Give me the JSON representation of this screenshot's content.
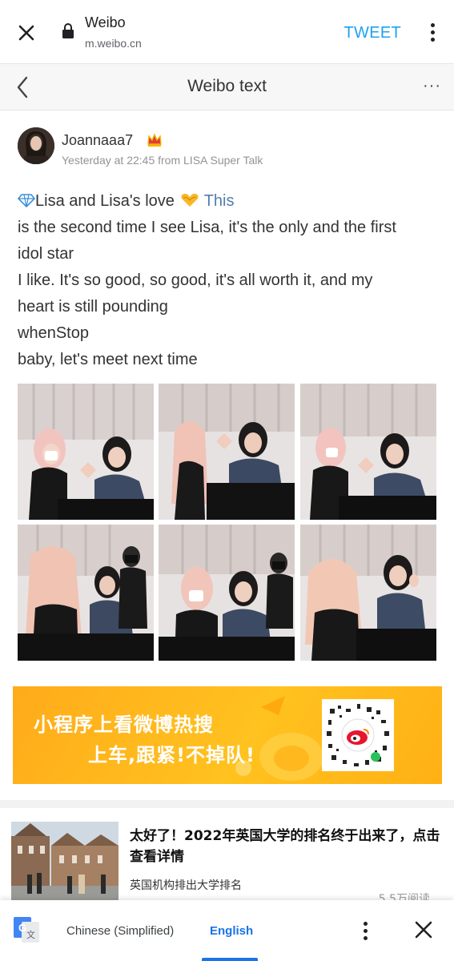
{
  "browser": {
    "site_title": "Weibo",
    "url": "m.weibo.cn",
    "action_label": "TWEET",
    "close_icon": "close-icon",
    "lock_icon": "lock-icon",
    "menu_icon": "more-vertical-icon"
  },
  "header": {
    "title": "Weibo text",
    "back_icon": "chevron-left-icon",
    "more_label": "···"
  },
  "post": {
    "username": "Joannaaa7",
    "meta": "Yesterday at 22:45 from LISA Super Talk",
    "lines": [
      "Lisa and Lisa's love",
      "This",
      "is the second time I see Lisa, it's the only and the first",
      "idol star",
      "I like. It's so good, so good, it's all worth it, and my",
      "heart is still pounding",
      "whenStop",
      "baby, let's meet next time"
    ],
    "photo_count": 6
  },
  "promo": {
    "line1": "小程序上看微博热搜",
    "line2": "上车,跟紧!不掉队!",
    "qr_icon": "qr-code-icon"
  },
  "article": {
    "title": "太好了！2022年英国大学的排名终于出来了，点击查看详情",
    "source": "英国机构排出大学排名",
    "views": "5.5万阅读"
  },
  "translate": {
    "source_lang": "Chinese (Simplified)",
    "target_lang": "English"
  },
  "colors": {
    "tweet": "#1da1f2",
    "link_blue": "#507daf",
    "promo_orange": "#ffb81c",
    "translate_blue": "#1a73e8"
  }
}
